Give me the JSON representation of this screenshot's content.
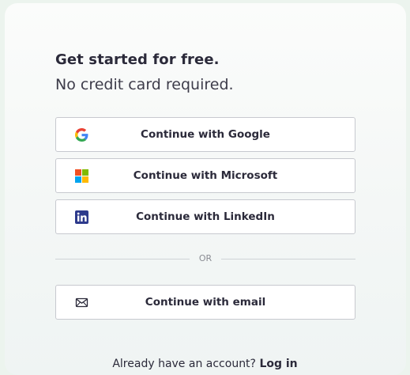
{
  "heading": {
    "title": "Get started for free.",
    "subtitle": "No credit card required."
  },
  "auth": {
    "google_label": "Continue with Google",
    "microsoft_label": "Continue with Microsoft",
    "linkedin_label": "Continue with LinkedIn",
    "divider": "OR",
    "email_label": "Continue with email"
  },
  "footer": {
    "prompt": "Already have an account?",
    "login_link": "Log in"
  },
  "colors": {
    "google_blue": "#4285F4",
    "google_green": "#34A853",
    "google_yellow": "#FBBC05",
    "google_red": "#EA4335",
    "ms_red": "#F25022",
    "ms_green": "#7FBA00",
    "ms_blue": "#00A4EF",
    "ms_yellow": "#FFB900",
    "linkedin": "#2D3A8C"
  },
  "icons": [
    "google-icon",
    "microsoft-icon",
    "linkedin-icon",
    "mail-icon"
  ]
}
